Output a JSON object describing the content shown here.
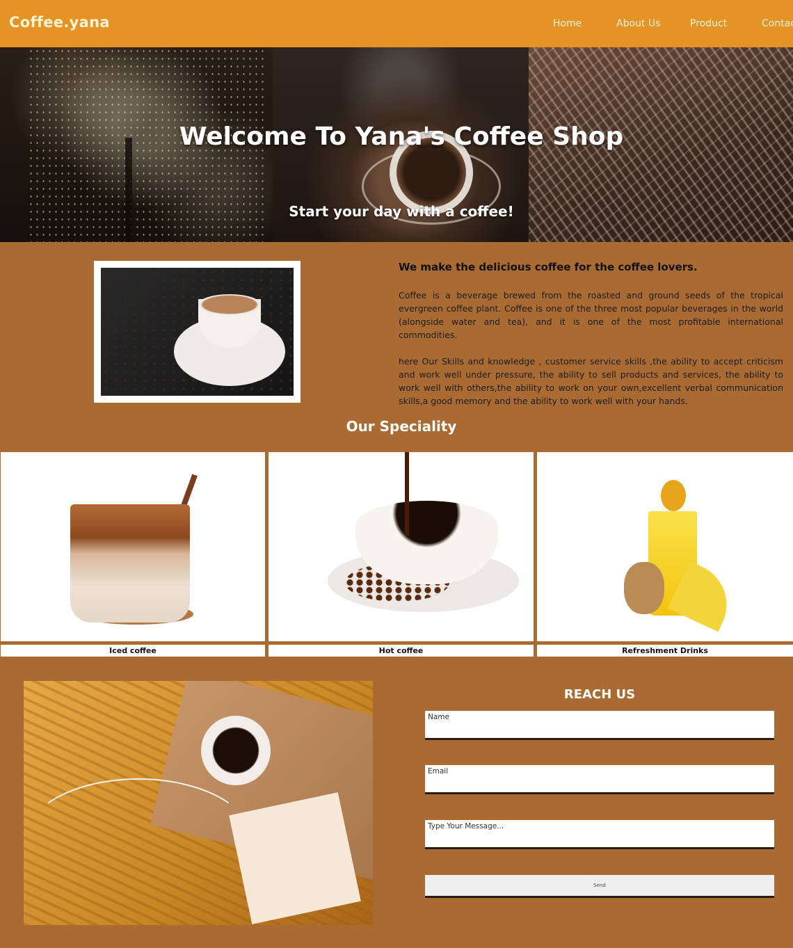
{
  "nav": {
    "logo": "Coffee.yana",
    "links": [
      "Home",
      "About Us",
      "Product",
      "Contact"
    ]
  },
  "hero": {
    "title": "Welcome To Yana's Coffee Shop",
    "subtitle": "Start your day with a coffee!"
  },
  "about": {
    "heading": "We make the delicious coffee for the coffee lovers.",
    "paragraphs": [
      "Coffee is a beverage brewed from the roasted and ground seeds of the tropical evergreen coffee plant. Coffee is one of the three most popular beverages in the world (alongside water and tea), and it is one of the most profitable international commodities.",
      "here Our Skills and knowledge , customer service skills ,the ability to accept criticism and work well under pressure, the ability to sell products and services, the ability to work well with others,the ability to work on your own,excellent verbal communication skills,a good memory and the ability to work well with your hands."
    ]
  },
  "speciality": {
    "title": "Our Speciality",
    "items": [
      {
        "label": "Iced coffee"
      },
      {
        "label": "Hot coffee"
      },
      {
        "label": "Refreshment Drinks"
      }
    ]
  },
  "contact": {
    "title": "REACH US",
    "name_label": "Name",
    "email_label": "Email",
    "message_label": "Type Your Message...",
    "send_label": "Send"
  },
  "colors": {
    "nav_bg": "#e59324",
    "page_bg": "#a96b32",
    "text_dark": "#111111"
  }
}
